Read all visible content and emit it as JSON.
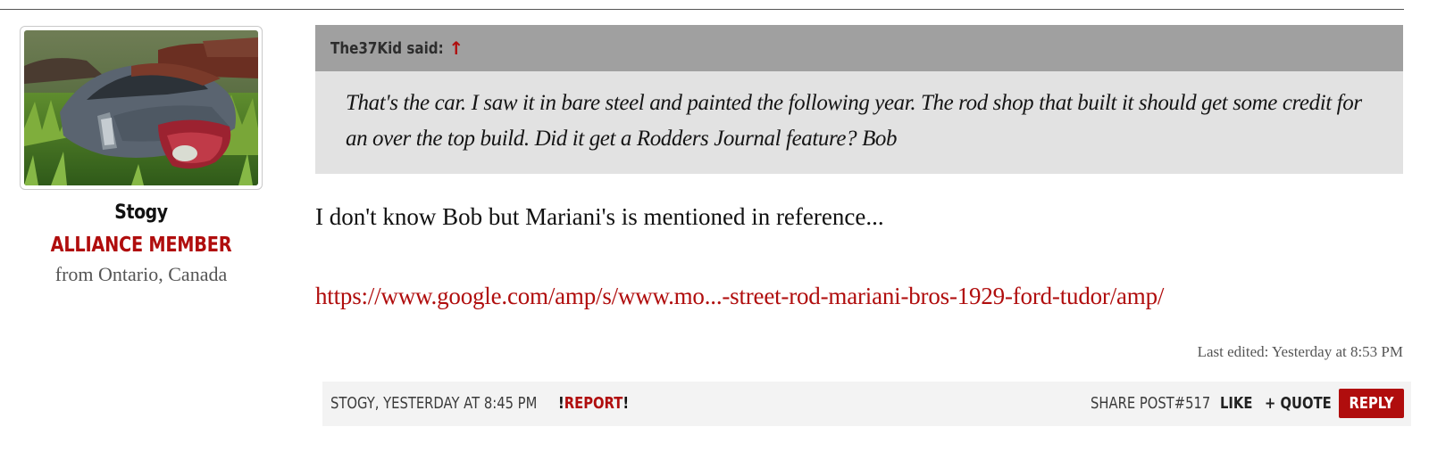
{
  "user": {
    "name": "Stogy",
    "title": "ALLIANCE MEMBER",
    "location": "from Ontario, Canada"
  },
  "quote": {
    "author": "The37Kid said:",
    "arrow": "↑",
    "text": "That's the car. I saw it in bare steel and painted the following year. The rod shop that built it should get some credit for an over the top build. Did it get a Rodders Journal feature? Bob"
  },
  "message": {
    "line": "I don't know Bob but Mariani's is mentioned in reference...",
    "link": "https://www.google.com/amp/s/www.mo...-street-rod-mariani-bros-1929-ford-tudor/amp/"
  },
  "last_edited": "Last edited: Yesterday at 8:53 PM",
  "footer": {
    "author_time": "STOGY, YESTERDAY AT 8:45 PM",
    "report_prefix": "!",
    "report_label": "REPORT",
    "report_suffix": "!",
    "share": "SHARE POST#517",
    "like": "LIKE",
    "quote": "+ QUOTE",
    "reply": "REPLY"
  },
  "colors": {
    "accent": "#b00d0d",
    "quote_header_bg": "#a0a0a0",
    "quote_body_bg": "#e2e2e2",
    "footer_bg": "#f3f3f3"
  }
}
